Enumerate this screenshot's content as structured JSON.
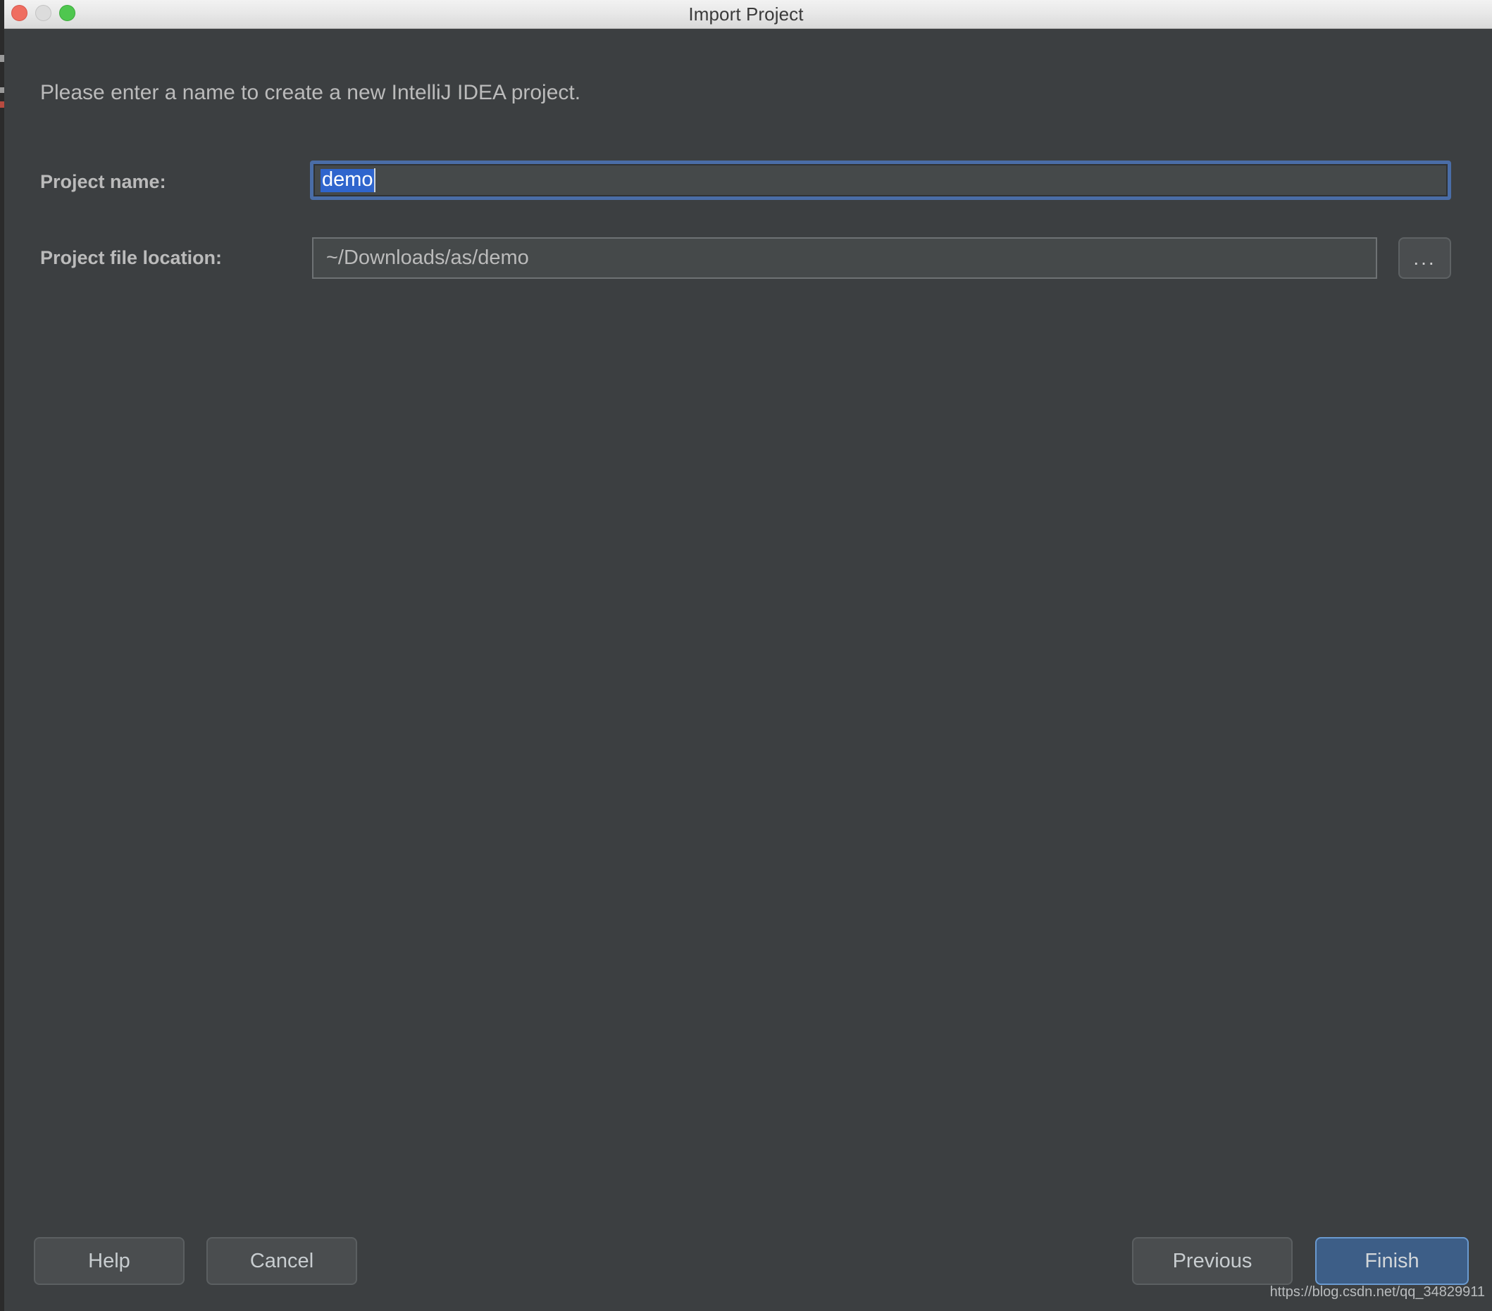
{
  "window": {
    "title": "Import Project",
    "traffic_lights": [
      {
        "name": "close",
        "color": "#ef6d60"
      },
      {
        "name": "minimize",
        "color": "#dcdcdc"
      },
      {
        "name": "zoom",
        "color": "#4fc74f"
      }
    ]
  },
  "content": {
    "intro": "Please enter a name to create a new IntelliJ IDEA project.",
    "fields": {
      "project_name": {
        "label": "Project name:",
        "value": "demo",
        "selected": true,
        "focused": true
      },
      "project_file_location": {
        "label": "Project file location:",
        "value": "~/Downloads/as/demo",
        "browse_label": "..."
      }
    }
  },
  "footer": {
    "help_label": "Help",
    "cancel_label": "Cancel",
    "previous_label": "Previous",
    "finish_label": "Finish"
  },
  "watermark": "https://blog.csdn.net/qq_34829911",
  "colors": {
    "dialog_bg": "#3c3f41",
    "field_bg": "#45494a",
    "label_text": "#bbbbbb",
    "focus_ring": "#4a6da7",
    "selection": "#2f65cd",
    "primary_button": "#3d5e87",
    "titlebar_text": "#3a3a3a"
  }
}
